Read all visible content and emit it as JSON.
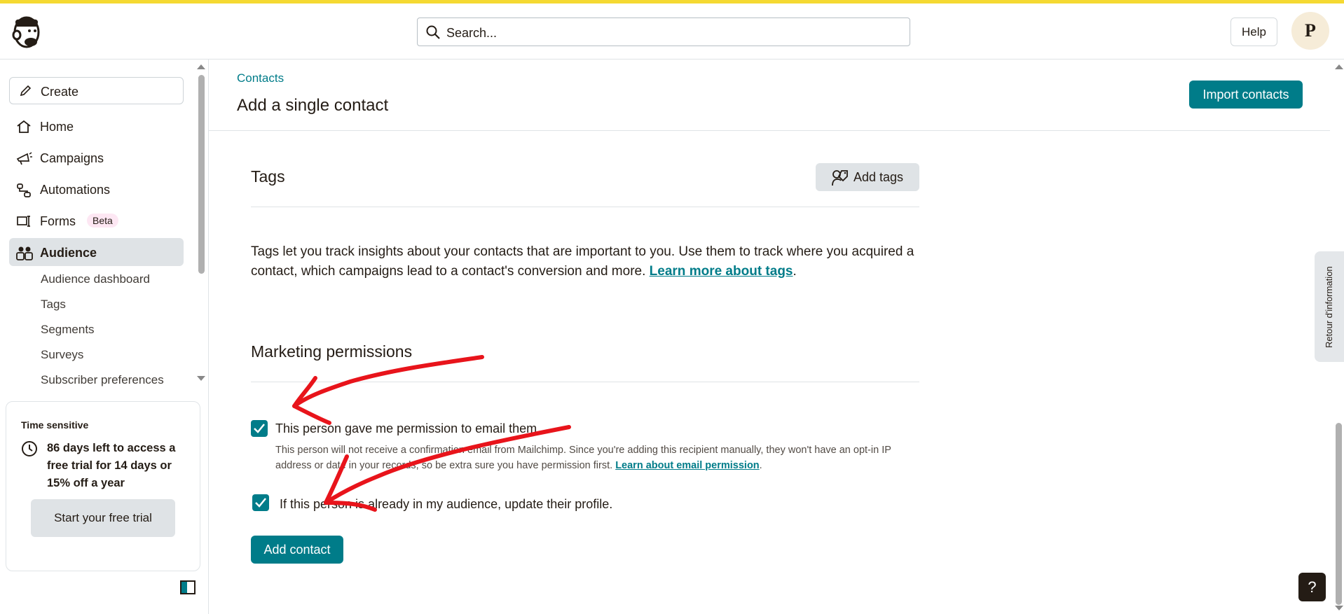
{
  "header": {
    "search_placeholder": "Search...",
    "help_label": "Help",
    "avatar_initial": "P",
    "accent_color": "#f5d932"
  },
  "sidebar": {
    "create_label": "Create",
    "nav": [
      {
        "label": "Home",
        "icon": "home-icon"
      },
      {
        "label": "Campaigns",
        "icon": "megaphone-icon"
      },
      {
        "label": "Automations",
        "icon": "automation-icon"
      },
      {
        "label": "Forms",
        "icon": "form-icon",
        "badge": "Beta"
      },
      {
        "label": "Audience",
        "icon": "audience-icon",
        "active": true
      }
    ],
    "audience_sub": [
      "Audience dashboard",
      "Tags",
      "Segments",
      "Surveys",
      "Subscriber preferences"
    ],
    "trial": {
      "heading": "Time sensitive",
      "message": "86 days left to access a free trial for 14 days or 15% off a year",
      "button": "Start your free trial"
    }
  },
  "page": {
    "breadcrumb": "Contacts",
    "title": "Add a single contact",
    "import_button": "Import contacts",
    "tags": {
      "title": "Tags",
      "add_button": "Add tags",
      "description": "Tags let you track insights about your contacts that are important to you. Use them to track where you acquired a contact, which campaigns lead to a contact's conversion and more.",
      "learn_more": "Learn more about tags",
      "period": "."
    },
    "permissions": {
      "title": "Marketing permissions",
      "checkbox1_label": "This person gave me permission to email them",
      "checkbox1_checked": true,
      "checkbox1_help": "This person will not receive a confirmation email from Mailchimp. Since you're adding this recipient manually, they won't have an opt-in IP address or date in your records, so be extra sure you have permission first.",
      "checkbox1_link": "Learn about email permission",
      "checkbox2_label": "If this person is already in my audience, update their profile.",
      "checkbox2_checked": true
    },
    "submit_button": "Add contact"
  },
  "feedback_tab": "Retour d'information",
  "help_fab": "?",
  "colors": {
    "brand_teal": "#007c89",
    "annotation_red": "#e8141b"
  }
}
